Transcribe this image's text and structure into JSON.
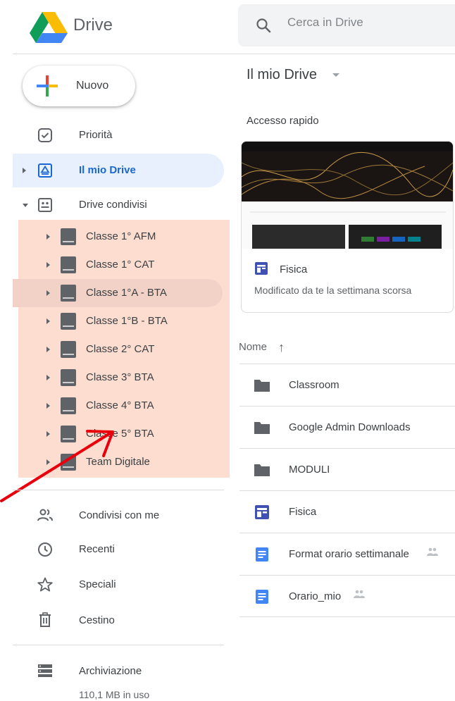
{
  "header": {
    "app_name": "Drive",
    "search_placeholder": "Cerca in Drive",
    "search_value": ""
  },
  "new_button": {
    "label": "Nuovo"
  },
  "nav": {
    "priority": "Priorità",
    "my_drive": "Il mio Drive",
    "shared_drives": "Drive condivisi",
    "shared_drive_items": [
      "Classe 1° AFM",
      "Classe 1° CAT",
      "Classe 1°A - BTA",
      "Classe 1°B - BTA",
      "Classe 2° CAT",
      "Classe 3° BTA",
      "Classe 4° BTA",
      "Classe 5° BTA",
      "Team Digitale"
    ],
    "shared_with_me": "Condivisi con me",
    "recent": "Recenti",
    "starred": "Speciali",
    "trash": "Cestino",
    "storage": "Archiviazione",
    "storage_used": "110,1 MB in uso"
  },
  "main": {
    "title": "Il mio Drive",
    "quick_access": "Accesso rapido",
    "quick_card": {
      "name": "Fisica",
      "subtitle": "Modificato da te la settimana scorsa"
    },
    "sort_label": "Nome",
    "sort_icon": "arrow-up-icon",
    "files": [
      {
        "name": "Classroom",
        "type": "folder"
      },
      {
        "name": "Google Admin Downloads",
        "type": "folder"
      },
      {
        "name": "MODULI",
        "type": "folder"
      },
      {
        "name": "Fisica",
        "type": "site"
      },
      {
        "name": "Format orario settimanale",
        "type": "doc",
        "shared": true
      },
      {
        "name": "Orario_mio",
        "type": "doc",
        "shared": true
      }
    ]
  },
  "colors": {
    "accent_blue": "#1967d2",
    "active_bg": "#e8f0fe",
    "highlight": "#fdddd0",
    "annotation_arrow": "#e8000d",
    "doc_blue": "#4285f4",
    "site_indigo": "#3f51b5"
  }
}
